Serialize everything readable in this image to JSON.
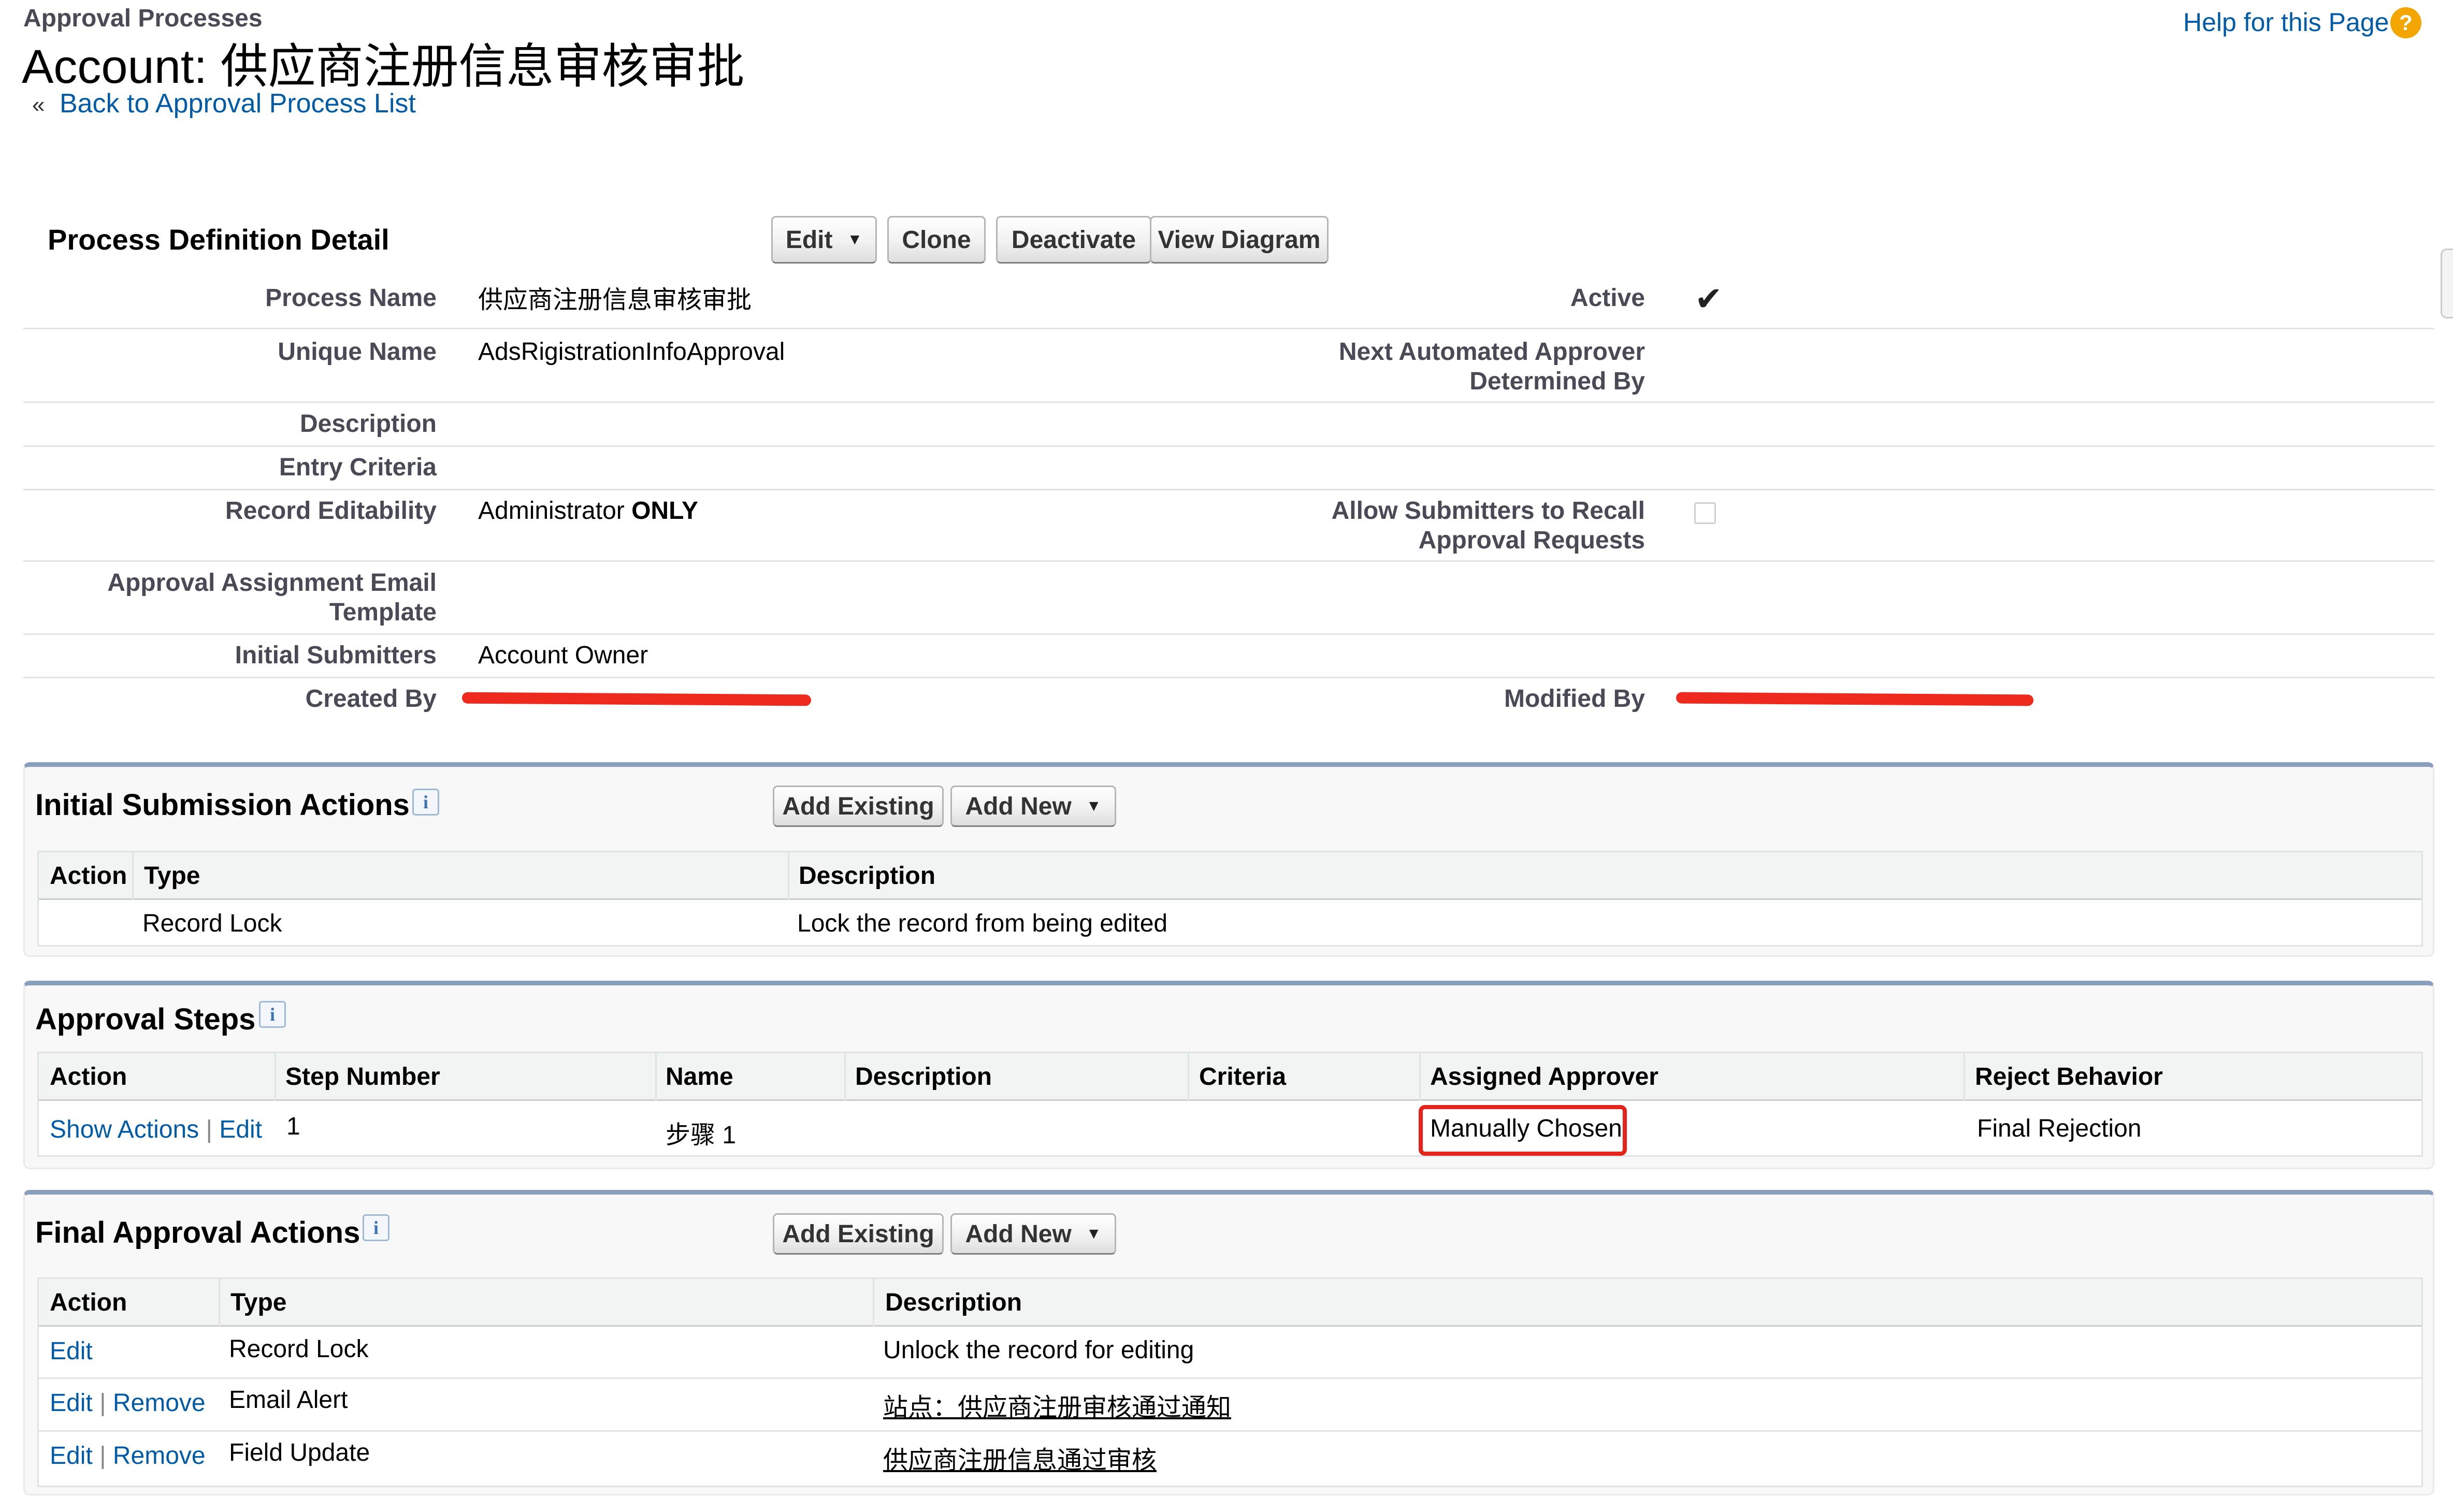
{
  "header": {
    "breadcrumb": "Approval Processes",
    "title": "Account: 供应商注册信息审核审批",
    "back_link": "Back to Approval Process List",
    "back_prefix": "«",
    "help_link": "Help for this Page",
    "help_icon_glyph": "?"
  },
  "detail": {
    "section_title": "Process Definition Detail",
    "buttons": {
      "edit": "Edit",
      "clone": "Clone",
      "deactivate": "Deactivate",
      "view_diagram": "View Diagram"
    },
    "fields": {
      "process_name_label": "Process Name",
      "process_name": "供应商注册信息审核审批",
      "active_label": "Active",
      "active_checked": true,
      "unique_name_label": "Unique Name",
      "unique_name": "AdsRigistrationInfoApproval",
      "next_approver_label_1": "Next Automated Approver",
      "next_approver_label_2": "Determined By",
      "description_label": "Description",
      "entry_criteria_label": "Entry Criteria",
      "record_editability_label": "Record Editability",
      "record_editability_value": "Administrator",
      "record_editability_strong": "ONLY",
      "allow_recall_label_1": "Allow Submitters to Recall",
      "allow_recall_label_2": "Approval Requests",
      "allow_recall_checked": false,
      "email_template_label_1": "Approval Assignment Email",
      "email_template_label_2": "Template",
      "initial_submitters_label": "Initial Submitters",
      "initial_submitters": "Account Owner",
      "created_by_label": "Created By",
      "modified_by_label": "Modified By"
    }
  },
  "initial_submission": {
    "title": "Initial Submission Actions",
    "info_glyph": "i",
    "add_existing": "Add Existing",
    "add_new": "Add New",
    "columns": [
      "Action",
      "Type",
      "Description"
    ],
    "rows": [
      {
        "action": "",
        "type": "Record Lock",
        "description": "Lock the record from being edited"
      }
    ]
  },
  "approval_steps": {
    "title": "Approval Steps",
    "info_glyph": "i",
    "columns": [
      "Action",
      "Step Number",
      "Name",
      "Description",
      "Criteria",
      "Assigned Approver",
      "Reject Behavior"
    ],
    "rows": [
      {
        "show_actions": "Show Actions",
        "sep": "|",
        "edit": "Edit",
        "step_number": "1",
        "name": "步骤 1",
        "description": "",
        "criteria": "",
        "assigned_approver": "Manually Chosen",
        "reject_behavior": "Final Rejection"
      }
    ],
    "highlight_color": "#e5251b"
  },
  "final_approval": {
    "title": "Final Approval Actions",
    "info_glyph": "i",
    "add_existing": "Add Existing",
    "add_new": "Add New",
    "columns": [
      "Action",
      "Type",
      "Description"
    ],
    "rows": [
      {
        "edit": "Edit",
        "sep": "",
        "remove": "",
        "type": "Record Lock",
        "description": "Unlock the record for editing"
      },
      {
        "edit": "Edit",
        "sep": "|",
        "remove": "Remove",
        "type": "Email Alert",
        "description": "站点：供应商注册审核通过通知"
      },
      {
        "edit": "Edit",
        "sep": "|",
        "remove": "Remove",
        "type": "Field Update",
        "description": "供应商注册信息通过审核"
      }
    ]
  },
  "colors": {
    "link": "#015ba7",
    "panel_border": "#8a9ebe",
    "help_icon": "#f3a600",
    "redaction": "#ee2a1e"
  }
}
